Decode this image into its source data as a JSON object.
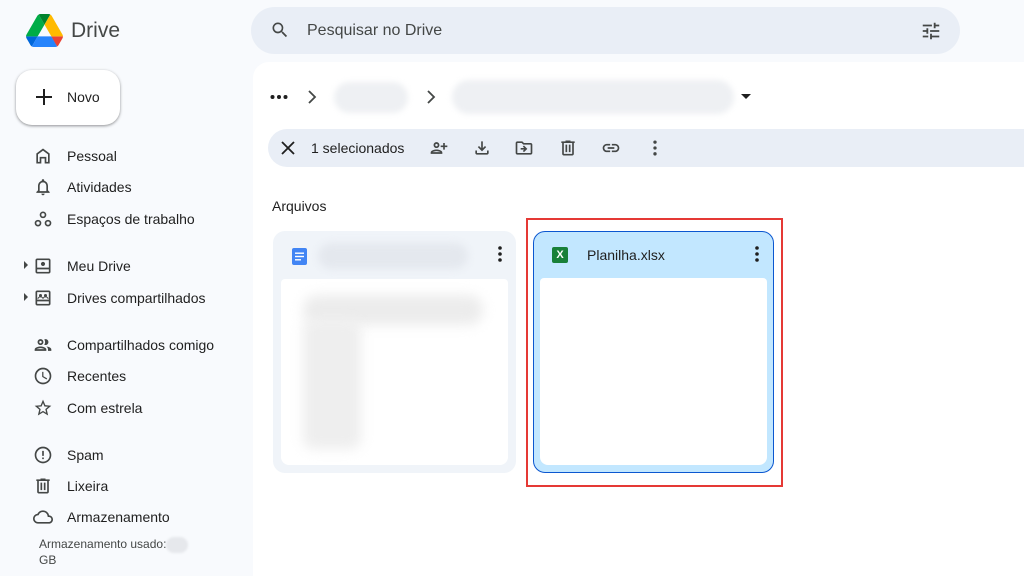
{
  "app": {
    "name": "Drive"
  },
  "search": {
    "placeholder": "Pesquisar no Drive"
  },
  "new_button": {
    "label": "Novo"
  },
  "sidebar": {
    "items": [
      {
        "label": "Pessoal",
        "icon": "home-icon"
      },
      {
        "label": "Atividades",
        "icon": "bell-icon"
      },
      {
        "label": "Espaços de trabalho",
        "icon": "workspaces-icon"
      },
      {
        "label": "Meu Drive",
        "icon": "my-drive-icon",
        "expandable": true
      },
      {
        "label": "Drives compartilhados",
        "icon": "shared-drives-icon",
        "expandable": true
      },
      {
        "label": "Compartilhados comigo",
        "icon": "people-icon"
      },
      {
        "label": "Recentes",
        "icon": "clock-icon"
      },
      {
        "label": "Com estrela",
        "icon": "star-icon"
      },
      {
        "label": "Spam",
        "icon": "spam-icon"
      },
      {
        "label": "Lixeira",
        "icon": "trash-icon"
      },
      {
        "label": "Armazenamento",
        "icon": "cloud-icon"
      }
    ],
    "storage_label": "Armazenamento usado:",
    "storage_unit": "GB"
  },
  "selection_bar": {
    "count_label": "1 selecionados",
    "actions": [
      "share-icon",
      "download-icon",
      "move-icon",
      "delete-icon",
      "link-icon",
      "more-icon"
    ]
  },
  "files": {
    "section_title": "Arquivos",
    "items": [
      {
        "name": "",
        "type": "document",
        "selected": false
      },
      {
        "name": "Planilha.xlsx",
        "type": "spreadsheet",
        "selected": true,
        "type_badge": "X"
      }
    ]
  },
  "colors": {
    "selected_card_bg": "#c2e7ff",
    "highlight_border": "#e53935",
    "sheets_green": "#188038",
    "docs_blue": "#4285f4"
  }
}
